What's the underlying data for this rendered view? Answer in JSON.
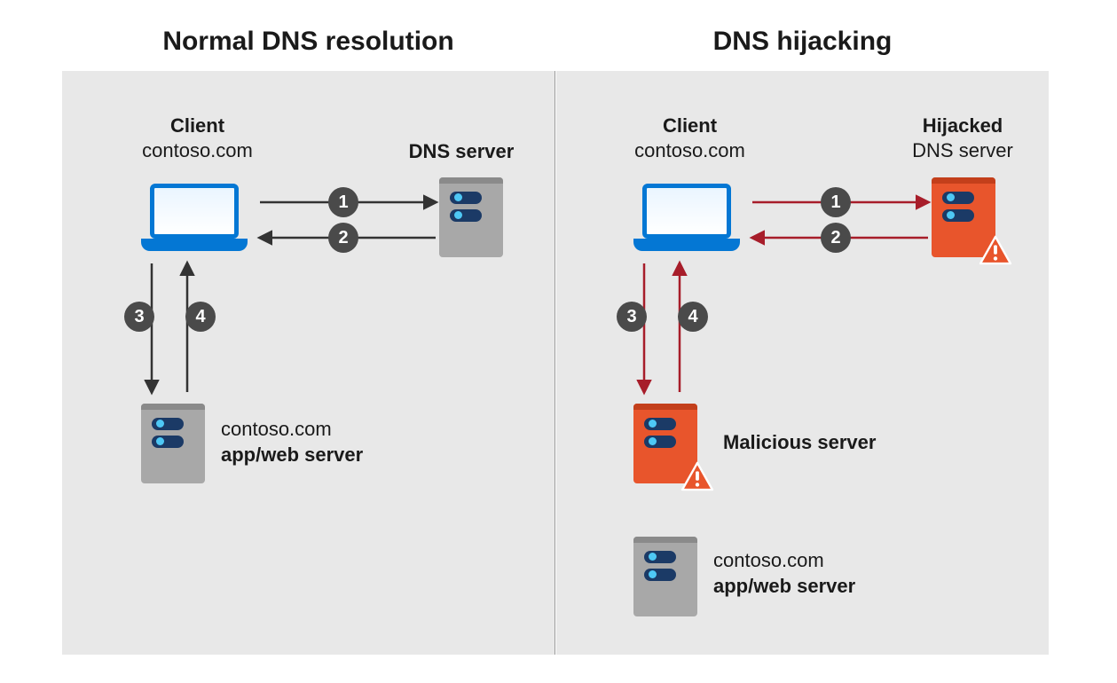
{
  "left": {
    "title": "Normal DNS resolution",
    "client_title": "Client",
    "client_domain": "contoso.com",
    "dns_server_label": "DNS server",
    "endpoint_line1": "contoso.com",
    "endpoint_line2": "app/web server",
    "steps": {
      "s1": "1",
      "s2": "2",
      "s3": "3",
      "s4": "4"
    }
  },
  "right": {
    "title": "DNS hijacking",
    "client_title": "Client",
    "client_domain": "contoso.com",
    "dns_line1": "Hijacked",
    "dns_line2": "DNS server",
    "malicious_label": "Malicious server",
    "real_line1": "contoso.com",
    "real_line2": "app/web server",
    "steps": {
      "s1": "1",
      "s2": "2",
      "s3": "3",
      "s4": "4"
    }
  },
  "colors": {
    "arrow_normal": "#333333",
    "arrow_attack": "#a71d2a"
  }
}
